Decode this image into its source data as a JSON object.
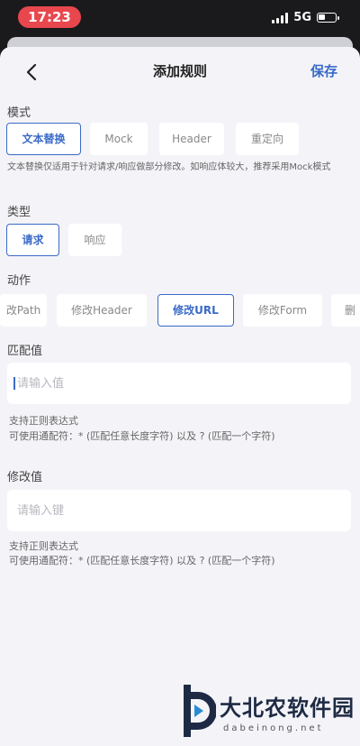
{
  "status_bar": {
    "time": "17:23",
    "network": "5G"
  },
  "nav": {
    "title": "添加规则",
    "save_label": "保存"
  },
  "mode": {
    "label": "模式",
    "options": [
      "文本替换",
      "Mock",
      "Header",
      "重定向"
    ],
    "selected": "文本替换",
    "description": "文本替换仅适用于针对请求/响应做部分修改。如响应体较大，推荐采用Mock模式"
  },
  "type": {
    "label": "类型",
    "options": [
      "请求",
      "响应"
    ],
    "selected": "请求"
  },
  "action": {
    "label": "动作",
    "options": [
      "改Path",
      "修改Header",
      "修改URL",
      "修改Form",
      "删"
    ],
    "selected": "修改URL"
  },
  "match": {
    "label": "匹配值",
    "placeholder": "请输入值",
    "hint_line1": "支持正则表达式",
    "hint_line2": "可使用通配符：* (匹配任意长度字符) 以及 ? (匹配一个字符)"
  },
  "modify": {
    "label": "修改值",
    "placeholder": "请输入键",
    "hint_line1": "支持正则表达式",
    "hint_line2": "可使用通配符：* (匹配任意长度字符) 以及 ? (匹配一个字符)"
  },
  "watermark": {
    "name": "大北农软件园",
    "url": "dabeinong.net"
  },
  "colors": {
    "accent": "#3a6ac8",
    "time_pill": "#e8474e",
    "sheet_bg": "#f4f4f8"
  }
}
